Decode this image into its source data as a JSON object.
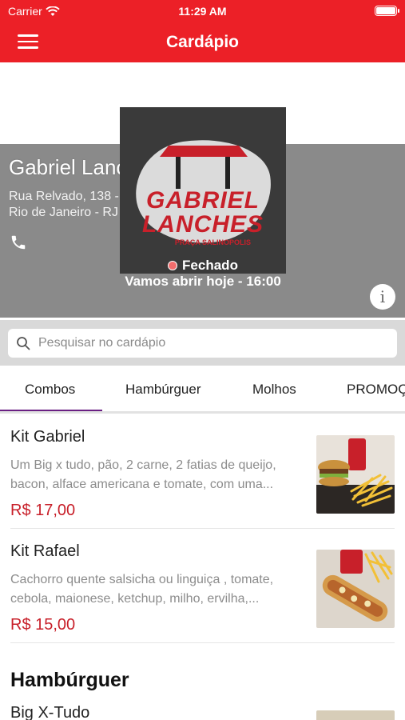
{
  "status_bar": {
    "carrier": "Carrier",
    "time": "11:29 AM"
  },
  "nav": {
    "title": "Cardápio"
  },
  "store": {
    "name": "Gabriel Lanches",
    "address_line1": "Rua Relvado, 138 - Taquara",
    "address_line2": "Rio de Janeiro - RJ",
    "status": "Fechado",
    "opening": "Vamos abrir hoje - 16:00",
    "logo": {
      "line1": "GABRIEL",
      "line2": "LANCHES",
      "tagline": "PRAÇA SALINOPOLIS"
    }
  },
  "search": {
    "placeholder": "Pesquisar no cardápio",
    "value": ""
  },
  "tabs": [
    {
      "label": "Combos",
      "active": true
    },
    {
      "label": "Hambúrguer",
      "active": false
    },
    {
      "label": "Molhos",
      "active": false
    },
    {
      "label": "PROMOÇ",
      "active": false
    }
  ],
  "items": [
    {
      "name": "Kit Gabriel",
      "desc_line1": "Um Big x tudo, pão, 2 carne, 2 fatias de queijo,",
      "desc_line2": "bacon, alface americana e tomate, com uma...",
      "price": "R$ 17,00"
    },
    {
      "name": "Kit Rafael",
      "desc_line1": "Cachorro quente salsicha ou linguiça , tomate,",
      "desc_line2": "cebola, maionese, ketchup, milho, ervilha,...",
      "price": "R$ 15,00"
    }
  ],
  "section": {
    "title": "Hambúrguer",
    "next_item": "Big X-Tudo"
  },
  "colors": {
    "brand_red": "#ec2027",
    "price_red": "#c8202a",
    "tab_indicator": "#6a2083"
  },
  "icons": [
    "wifi-icon",
    "battery-icon",
    "menu-icon",
    "phone-icon",
    "info-icon",
    "search-icon"
  ]
}
